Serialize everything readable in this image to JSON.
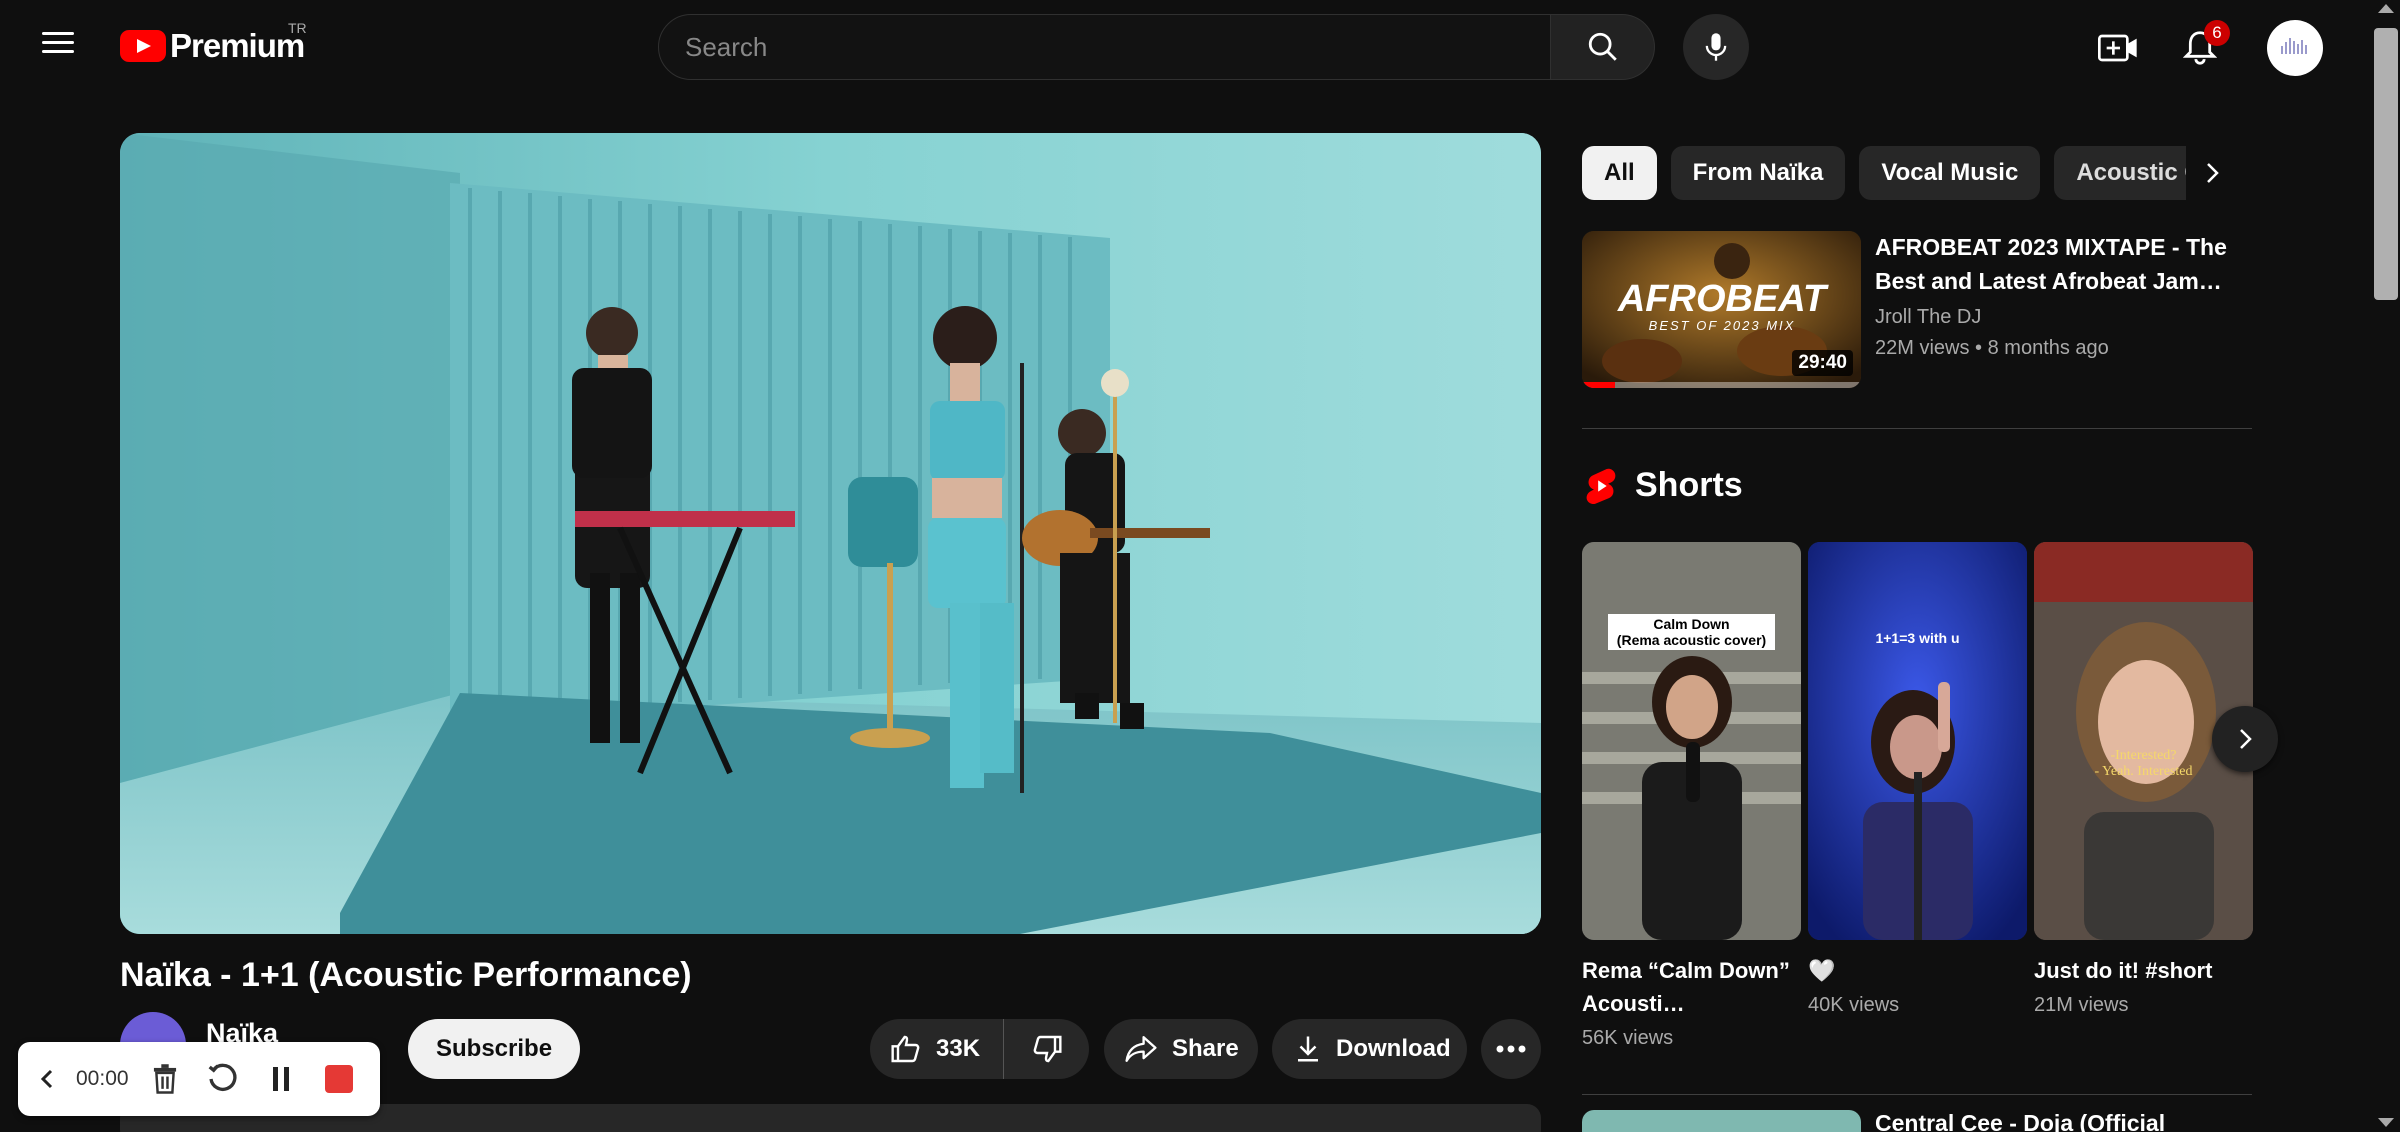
{
  "header": {
    "logo_text": "Premium",
    "country_code": "TR",
    "search_placeholder": "Search",
    "notification_count": "6",
    "icons": [
      "menu-icon",
      "search-icon",
      "mic-icon",
      "create-icon",
      "bell-icon"
    ]
  },
  "video": {
    "title": "Naïka - 1+1 (Acoustic Performance)",
    "channel_name": "Naïka",
    "subscribe_label": "Subscribe",
    "like_count": "33K",
    "share_label": "Share",
    "download_label": "Download"
  },
  "recorder": {
    "time": "00:00",
    "stop_color": "#e53935"
  },
  "chips": [
    {
      "label": "All",
      "active": true
    },
    {
      "label": "From Naïka",
      "active": false
    },
    {
      "label": "Vocal Music",
      "active": false
    },
    {
      "label": "Acoustic Gu",
      "active": false
    }
  ],
  "recommendations": [
    {
      "title": "AFROBEAT 2023 MIXTAPE - The Best and Latest Afrobeat Jam…",
      "channel": "Jroll The DJ",
      "views": "22M views",
      "age": "8 months ago",
      "duration": "29:40",
      "thumb_text": "AFROBEAT",
      "thumb_subtext": "BEST OF 2023 MIX",
      "watched_fraction": 0.12
    },
    {
      "title": "Central Cee - Doja (Official"
    }
  ],
  "shorts": {
    "heading": "Shorts",
    "items": [
      {
        "title": "Rema “Calm Down” Acousti…",
        "views": "56K views",
        "caption": "Calm Down\n(Rema acoustic cover)"
      },
      {
        "title": "🤍",
        "views": "40K views",
        "caption": "1+1=3 with u"
      },
      {
        "title": "Just do it! #short",
        "views": "21M views",
        "caption": "-Interested?\n- Yeah. Interested"
      }
    ]
  },
  "colors": {
    "background": "#0f0f0f",
    "brand_red": "#ff0000",
    "chip_active_bg": "#f1f1f1",
    "surface": "#272727"
  }
}
